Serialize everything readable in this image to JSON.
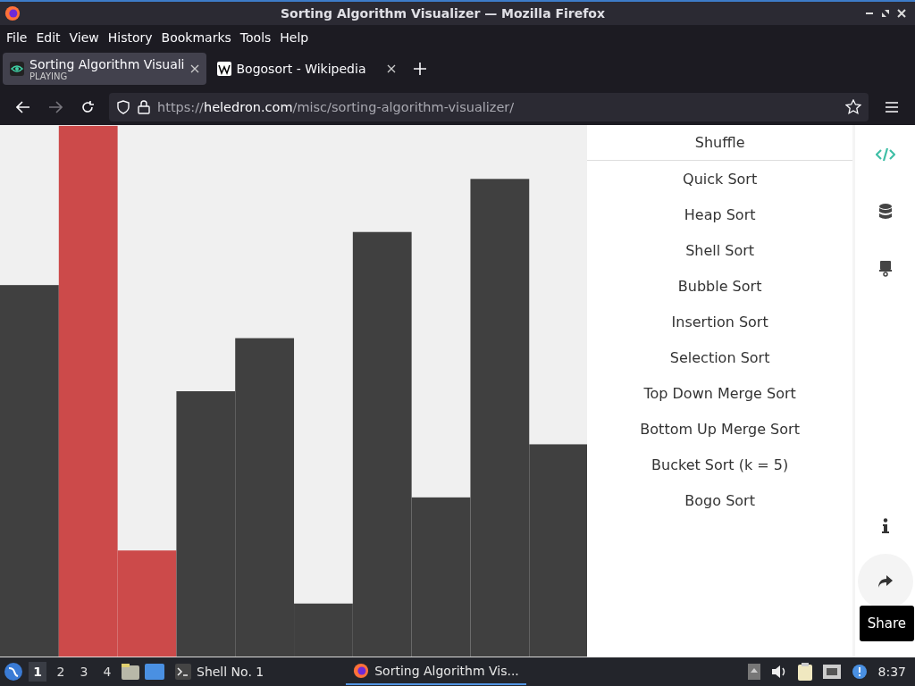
{
  "window": {
    "title": "Sorting Algorithm Visualizer — Mozilla Firefox"
  },
  "menu": [
    "File",
    "Edit",
    "View",
    "History",
    "Bookmarks",
    "Tools",
    "Help"
  ],
  "tabs": [
    {
      "title": "Sorting Algorithm Visuali",
      "status": "PLAYING",
      "selected": true
    },
    {
      "title": "Bogosort - Wikipedia",
      "selected": false
    }
  ],
  "address": {
    "scheme": "https://",
    "domain": "heledron.com",
    "path": "/misc/sorting-algorithm-visualizer/"
  },
  "page": {
    "shuffle": "Shuffle",
    "algorithms": [
      "Quick Sort",
      "Heap Sort",
      "Shell Sort",
      "Bubble Sort",
      "Insertion Sort",
      "Selection Sort",
      "Top Down Merge Sort",
      "Bottom Up Merge Sort",
      "Bucket Sort (k = 5)",
      "Bogo Sort"
    ],
    "tooltip": "Share"
  },
  "taskbar": {
    "workspaces": [
      {
        "label": "1",
        "selected": true
      },
      {
        "label": "2",
        "selected": false
      },
      {
        "label": "3",
        "selected": false
      },
      {
        "label": "4",
        "selected": false
      }
    ],
    "terminal": "Shell No. 1",
    "window": "Sorting Algorithm Vis...",
    "clock": "8:37"
  }
}
